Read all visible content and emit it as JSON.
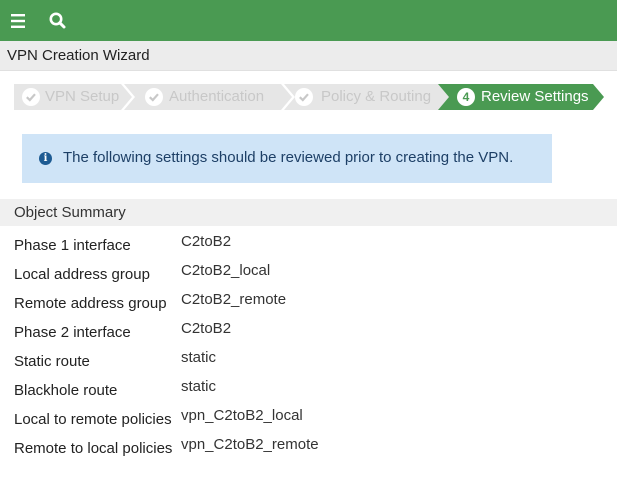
{
  "topbar": {
    "menu_icon": "hamburger-menu-icon",
    "search_icon": "search-icon",
    "color": "#4a9a52"
  },
  "wizard": {
    "title": "VPN Creation Wizard",
    "steps": [
      {
        "label": "VPN Setup",
        "state": "completed",
        "icon": "check-icon"
      },
      {
        "label": "Authentication",
        "state": "completed",
        "icon": "check-icon"
      },
      {
        "label": "Policy & Routing",
        "state": "completed",
        "icon": "check-icon"
      },
      {
        "label": "Review Settings",
        "state": "active",
        "number": "4"
      }
    ]
  },
  "info": {
    "icon": "info-icon",
    "message": "The following settings should be reviewed prior to creating the VPN."
  },
  "summary": {
    "title": "Object Summary",
    "rows": [
      {
        "key": "Phase 1 interface",
        "value": "C2toB2"
      },
      {
        "key": "Local address group",
        "value": "C2toB2_local"
      },
      {
        "key": "Remote address group",
        "value": "C2toB2_remote"
      },
      {
        "key": "Phase 2 interface",
        "value": "C2toB2"
      },
      {
        "key": "Static route",
        "value": "static"
      },
      {
        "key": "Blackhole route",
        "value": "static"
      },
      {
        "key": "Local to remote policies",
        "value": "vpn_C2toB2_local"
      },
      {
        "key": "Remote to local policies",
        "value": "vpn_C2toB2_remote"
      }
    ]
  }
}
